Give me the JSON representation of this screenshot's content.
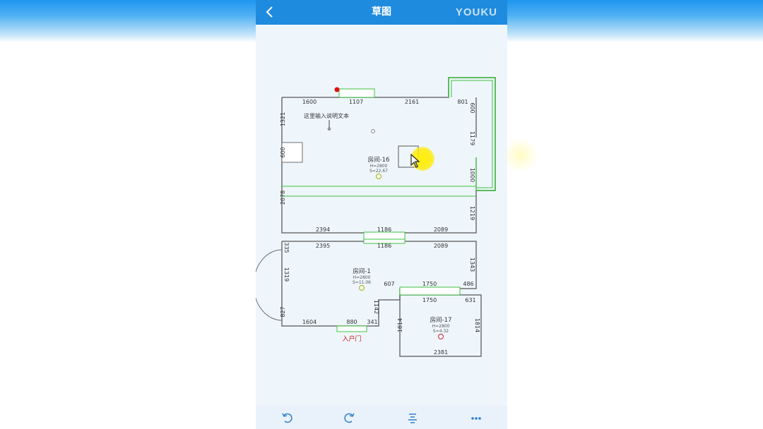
{
  "app": {
    "title": "草图",
    "watermark": "YOUKU"
  },
  "annotation": {
    "text": "这里输入说明文本"
  },
  "rooms": [
    {
      "name": "房间-16",
      "height": "H=2800",
      "area": "S=22.67"
    },
    {
      "name": "房间-1",
      "height": "H=2800",
      "area": "S=11.06"
    },
    {
      "name": "房间-17",
      "height": "H=2800",
      "area": "S=4.32"
    }
  ],
  "entrance": {
    "label": "入户门"
  },
  "dims": {
    "d1600": "1600",
    "d1107": "1107",
    "d2161": "2161",
    "d801": "801",
    "d600r": "600",
    "d1179": "1179",
    "d1000": "1000",
    "d1219": "1219",
    "d1321": "1321",
    "d600l": "600",
    "d2078": "2078",
    "d2394": "2394",
    "d1186a": "1186",
    "d2089a": "2089",
    "d2395": "2395",
    "d1186b": "1186",
    "d2089b": "2089",
    "d335": "335",
    "d1319": "1319",
    "d827": "827",
    "d1343": "1343",
    "d607": "607",
    "d1750a": "1750",
    "d486": "486",
    "d1142": "1142",
    "d1604": "1604",
    "d880": "880",
    "d341": "341",
    "d1750b": "1750",
    "d631": "631",
    "d1814l": "1814",
    "d1814r": "1814",
    "d2381": "2381"
  },
  "toolbar": {
    "undo": "undo",
    "redo": "redo",
    "align": "align",
    "more": "more"
  }
}
